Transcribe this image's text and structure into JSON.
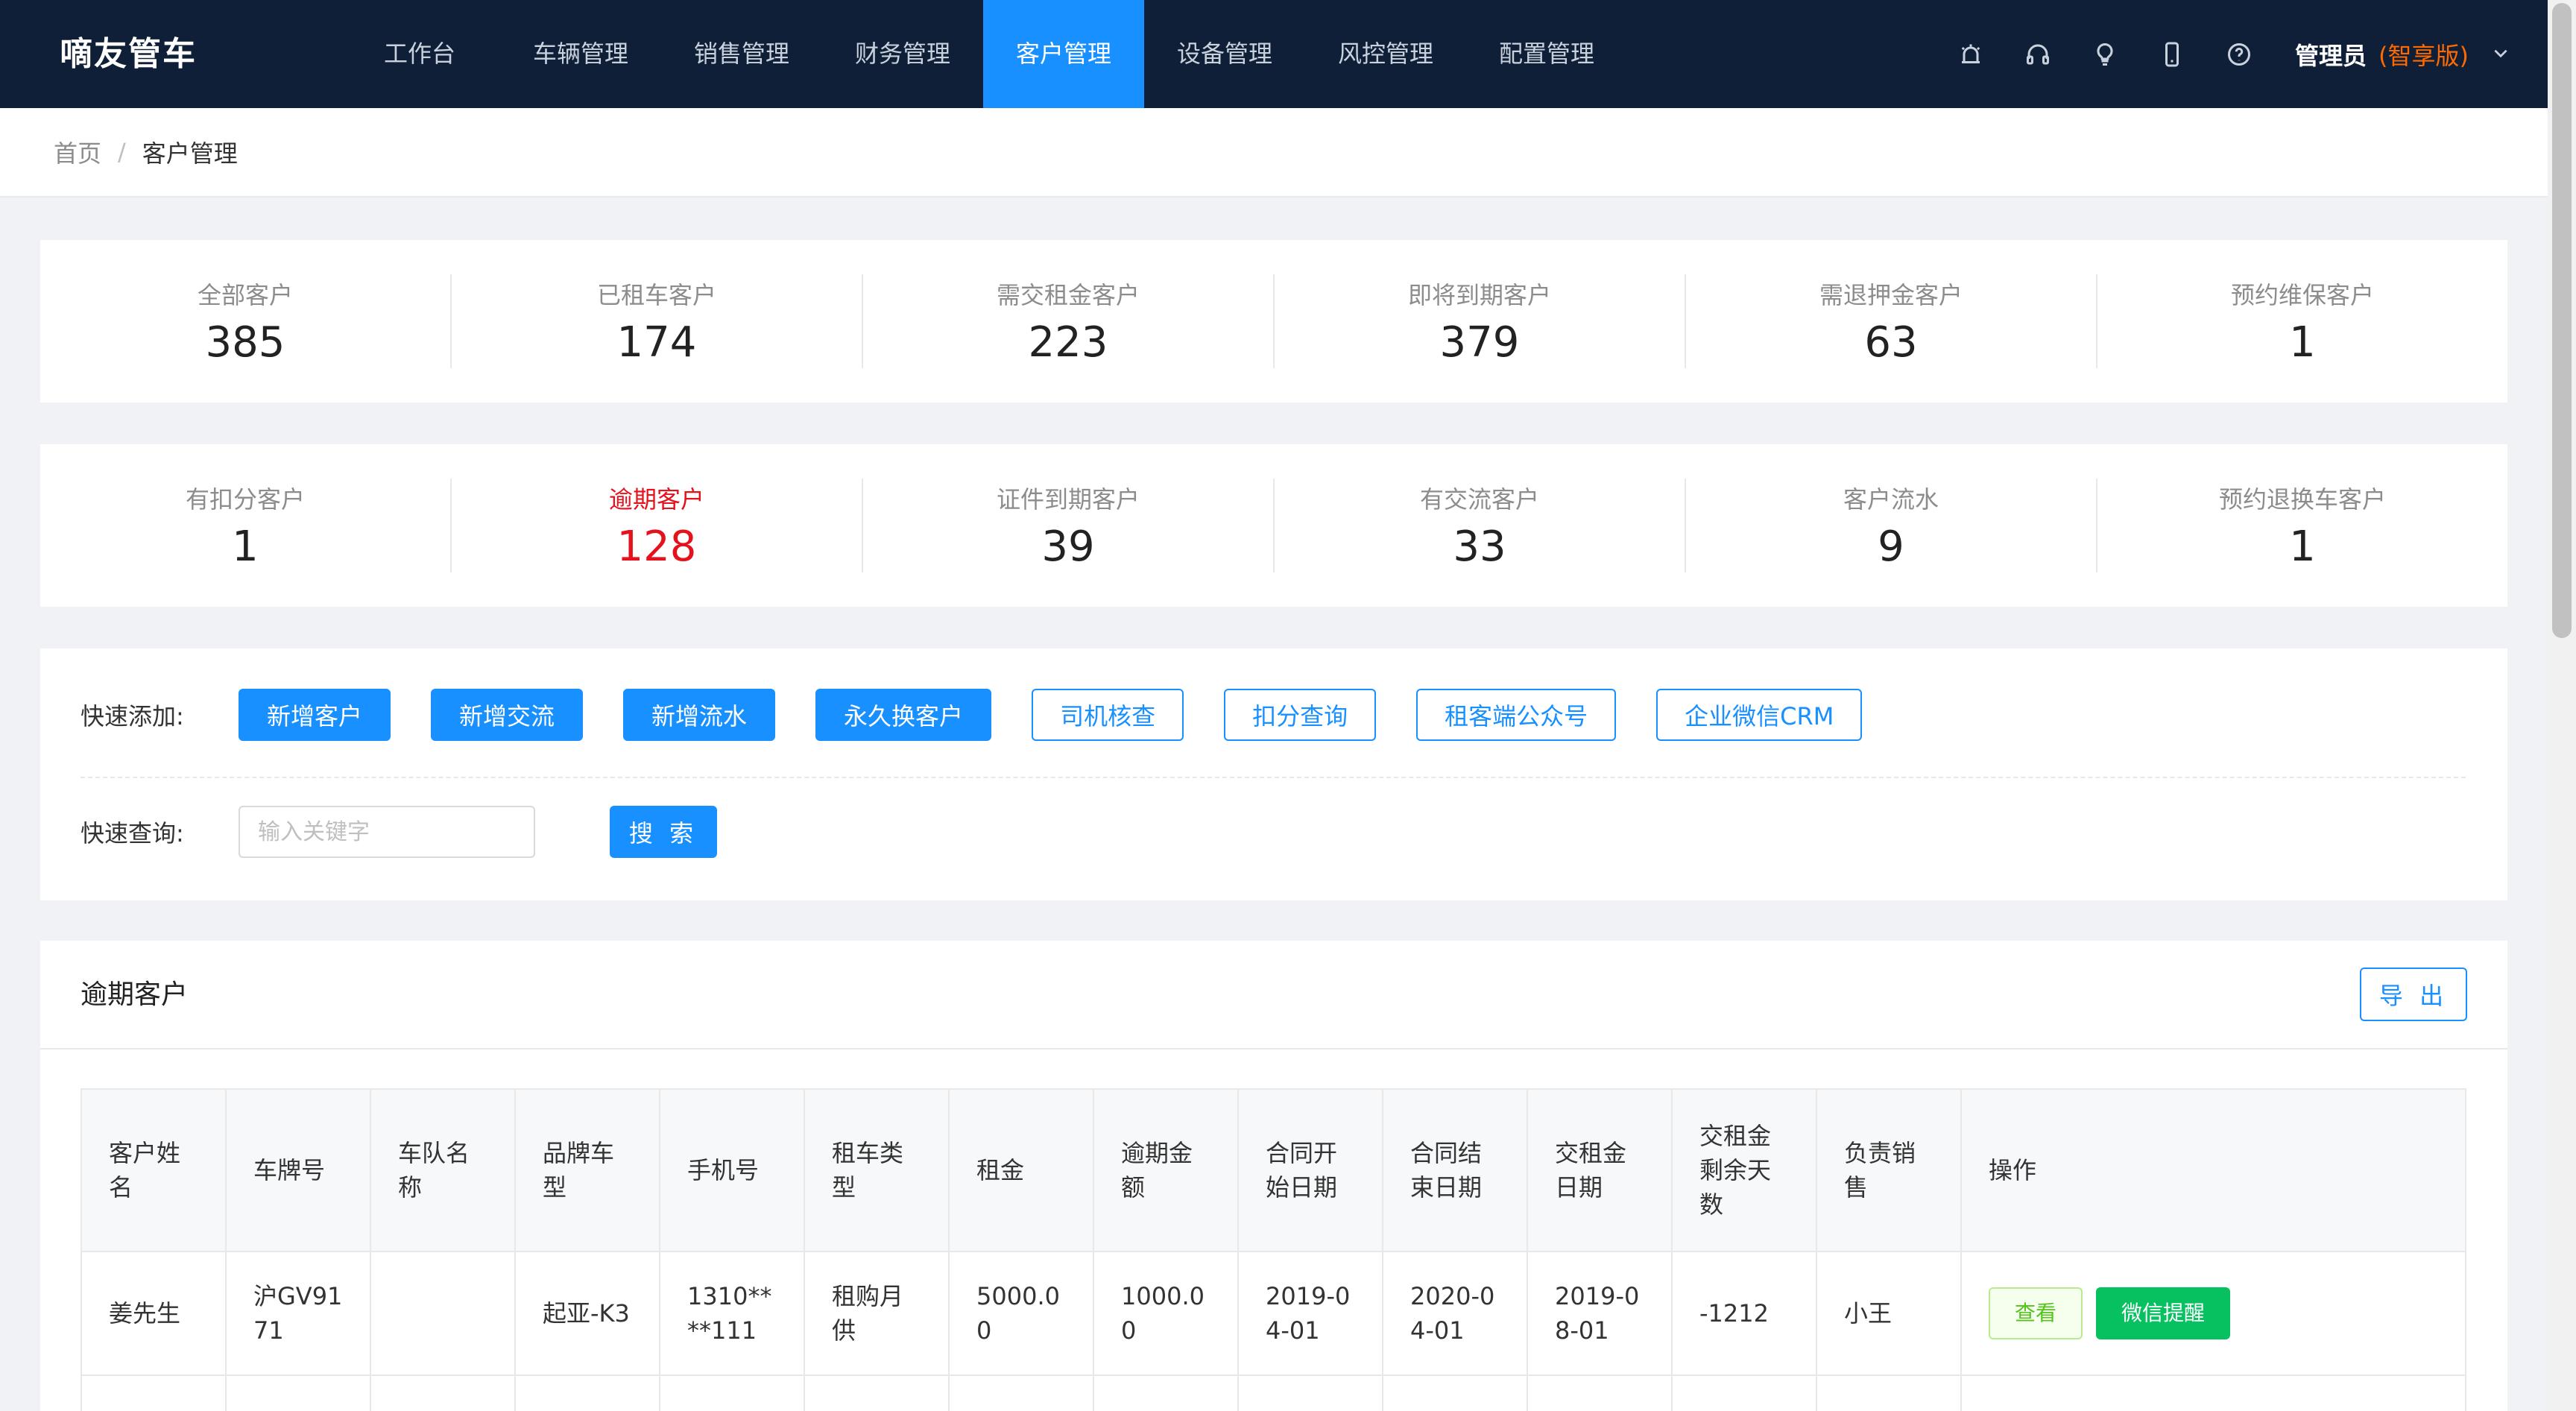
{
  "app": {
    "title": "嘀友管车"
  },
  "nav": {
    "items": [
      {
        "label": "工作台"
      },
      {
        "label": "车辆管理"
      },
      {
        "label": "销售管理"
      },
      {
        "label": "财务管理"
      },
      {
        "label": "客户管理",
        "active": true
      },
      {
        "label": "设备管理"
      },
      {
        "label": "风控管理"
      },
      {
        "label": "配置管理"
      }
    ]
  },
  "header": {
    "icons": [
      "alarm-icon",
      "headset-icon",
      "lightbulb-icon",
      "mobile-icon",
      "help-icon"
    ],
    "user_name": "管理员",
    "user_edition": "(智享版)"
  },
  "breadcrumb": {
    "home": "首页",
    "separator": "/",
    "current": "客户管理"
  },
  "stats_row1": [
    {
      "label": "全部客户",
      "value": "385"
    },
    {
      "label": "已租车客户",
      "value": "174"
    },
    {
      "label": "需交租金客户",
      "value": "223"
    },
    {
      "label": "即将到期客户",
      "value": "379"
    },
    {
      "label": "需退押金客户",
      "value": "63"
    },
    {
      "label": "预约维保客户",
      "value": "1"
    }
  ],
  "stats_row2": [
    {
      "label": "有扣分客户",
      "value": "1"
    },
    {
      "label": "逾期客户",
      "value": "128",
      "highlight": "#e5121e"
    },
    {
      "label": "证件到期客户",
      "value": "39"
    },
    {
      "label": "有交流客户",
      "value": "33"
    },
    {
      "label": "客户流水",
      "value": "9"
    },
    {
      "label": "预约退换车客户",
      "value": "1"
    }
  ],
  "quick": {
    "add_label": "快速添加:",
    "buttons": [
      {
        "label": "新增客户",
        "style": "solid"
      },
      {
        "label": "新增交流",
        "style": "solid"
      },
      {
        "label": "新增流水",
        "style": "solid"
      },
      {
        "label": "永久换客户",
        "style": "solid"
      },
      {
        "label": "司机核查",
        "style": "outline"
      },
      {
        "label": "扣分查询",
        "style": "outline"
      },
      {
        "label": "租客端公众号",
        "style": "outline"
      },
      {
        "label": "企业微信CRM",
        "style": "outline"
      }
    ],
    "search_label": "快速查询:",
    "search_placeholder": "输入关键字",
    "search_button": "搜 索"
  },
  "overdue": {
    "title": "逾期客户",
    "export_label": "导 出",
    "columns": [
      "客户姓名",
      "车牌号",
      "车队名称",
      "品牌车型",
      "手机号",
      "租车类型",
      "租金",
      "逾期金额",
      "合同开始日期",
      "合同结束日期",
      "交租金日期",
      "交租金剩余天数",
      "负责销售",
      "操作"
    ],
    "rows": [
      {
        "cells": [
          "姜先生",
          "沪GV9171",
          "",
          "起亚-K3",
          "1310****111",
          "租购月供",
          "5000.00",
          "1000.00",
          "2019-04-01",
          "2020-04-01",
          "2019-08-01",
          "-1212",
          "小王"
        ],
        "actions": {
          "view": "查看",
          "wechat": "微信提醒"
        }
      }
    ]
  },
  "colors": {
    "header_bg": "#0f1f38",
    "primary": "#1890ff",
    "danger": "#e5121e",
    "wechat": "#07c160",
    "edition": "#ff6a00"
  }
}
